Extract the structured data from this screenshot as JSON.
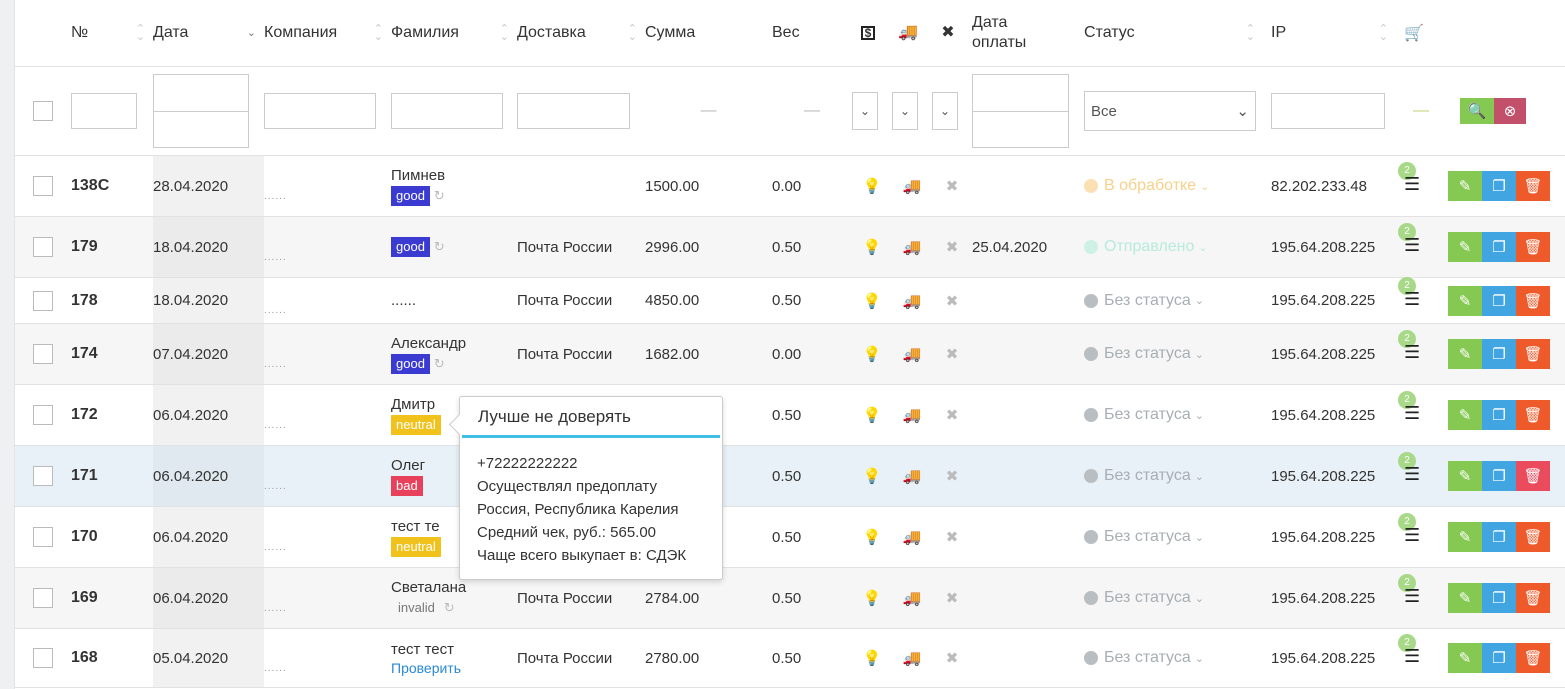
{
  "columns": {
    "num": "№",
    "date": "Дата",
    "company": "Компания",
    "lastname": "Фамилия",
    "delivery": "Доставка",
    "sum": "Сумма",
    "weight": "Вес",
    "paid_icon": "money-icon",
    "truck_icon": "truck-icon",
    "x_icon": "close-icon",
    "paydate": "Дата оплаты",
    "status": "Статус",
    "ip": "IP",
    "cart_icon": "cart-icon"
  },
  "filter": {
    "status_value": "Все",
    "sum_dash": "—",
    "weight_dash": "—",
    "ip_dash": "—"
  },
  "rows": [
    {
      "num": "138C",
      "date": "28.04.2020",
      "company": "......",
      "lastname": "Пимнев",
      "tag": "good",
      "tag_class": "good",
      "refresh": "↻",
      "verify": "",
      "delivery": "",
      "sum": "1500.00",
      "weight": "0.00",
      "paydate": "",
      "status": "В обработке",
      "status_class": "st-proc",
      "ip": "82.202.233.48",
      "badge": "2"
    },
    {
      "num": "179",
      "date": "18.04.2020",
      "company": "......",
      "lastname": "",
      "tag": "good",
      "tag_class": "good",
      "refresh": "↻",
      "verify": "",
      "delivery": "Почта России",
      "sum": "2996.00",
      "weight": "0.50",
      "paydate": "25.04.2020",
      "status": "Отправлено",
      "status_class": "st-sent",
      "ip": "195.64.208.225",
      "badge": "2"
    },
    {
      "num": "178",
      "date": "18.04.2020",
      "company": "......",
      "lastname": "......",
      "tag": "",
      "tag_class": "",
      "refresh": "",
      "verify": "",
      "delivery": "Почта России",
      "sum": "4850.00",
      "weight": "0.50",
      "paydate": "",
      "status": "Без статуса",
      "status_class": "st-none",
      "ip": "195.64.208.225",
      "badge": "2"
    },
    {
      "num": "174",
      "date": "07.04.2020",
      "company": "......",
      "lastname": "Александр",
      "tag": "good",
      "tag_class": "good",
      "refresh": "↻",
      "verify": "",
      "delivery": "Почта России",
      "sum": "1682.00",
      "weight": "0.00",
      "paydate": "",
      "status": "Без статуса",
      "status_class": "st-none",
      "ip": "195.64.208.225",
      "badge": "2"
    },
    {
      "num": "172",
      "date": "06.04.2020",
      "company": "......",
      "lastname": "Дмитр",
      "tag": "neutral",
      "tag_class": "neutral",
      "refresh": "",
      "verify": "",
      "delivery": "",
      "sum": "",
      "weight": "0.50",
      "paydate": "",
      "status": "Без статуса",
      "status_class": "st-none",
      "ip": "195.64.208.225",
      "badge": "2"
    },
    {
      "num": "171",
      "date": "06.04.2020",
      "company": "......",
      "lastname": "Олег",
      "tag": "bad",
      "tag_class": "bad",
      "refresh": "",
      "verify": "",
      "delivery": "",
      "sum": "",
      "weight": "0.50",
      "paydate": "",
      "status": "Без статуса",
      "status_class": "st-none",
      "ip": "195.64.208.225",
      "badge": "2"
    },
    {
      "num": "170",
      "date": "06.04.2020",
      "company": "......",
      "lastname": "тест те",
      "tag": "neutral",
      "tag_class": "neutral",
      "refresh": "",
      "verify": "",
      "delivery": "",
      "sum": "",
      "weight": "0.50",
      "paydate": "",
      "status": "Без статуса",
      "status_class": "st-none",
      "ip": "195.64.208.225",
      "badge": "2"
    },
    {
      "num": "169",
      "date": "06.04.2020",
      "company": "......",
      "lastname": "Светалана",
      "tag": "invalid",
      "tag_class": "invalid",
      "refresh": "↻",
      "verify": "",
      "delivery": "Почта России",
      "sum": "2784.00",
      "weight": "0.50",
      "paydate": "",
      "status": "Без статуса",
      "status_class": "st-none",
      "ip": "195.64.208.225",
      "badge": "2"
    },
    {
      "num": "168",
      "date": "05.04.2020",
      "company": "......",
      "lastname": "тест тест",
      "tag": "",
      "tag_class": "",
      "refresh": "",
      "verify": "Проверить",
      "delivery": "Почта России",
      "sum": "2780.00",
      "weight": "0.50",
      "paydate": "",
      "status": "Без статуса",
      "status_class": "st-none",
      "ip": "195.64.208.225",
      "badge": "2"
    }
  ],
  "tooltip": {
    "title": "Лучше не доверять",
    "lines": [
      "+72222222222",
      "Осуществлял предоплату",
      "Россия, Республика Карелия",
      "Средний чек, руб.: 565.00",
      "Чаще всего выкупает в: СДЭК"
    ]
  }
}
